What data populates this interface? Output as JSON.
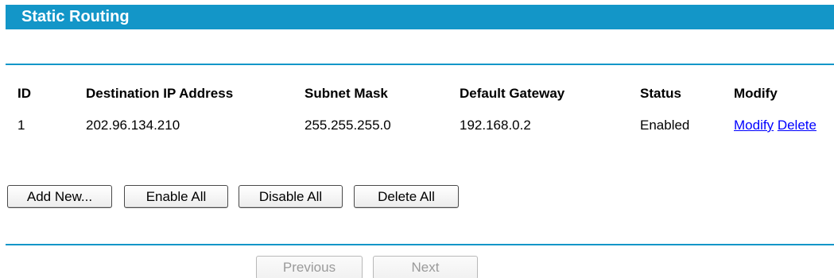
{
  "header": {
    "title": "Static Routing"
  },
  "table": {
    "columns": [
      "ID",
      "Destination IP Address",
      "Subnet Mask",
      "Default Gateway",
      "Status",
      "Modify"
    ],
    "rows": [
      {
        "id": "1",
        "destination": "202.96.134.210",
        "subnet_mask": "255.255.255.0",
        "gateway": "192.168.0.2",
        "status": "Enabled",
        "modify_label": "Modify",
        "delete_label": "Delete"
      }
    ]
  },
  "actions": {
    "add_new": "Add New...",
    "enable_all": "Enable All",
    "disable_all": "Disable All",
    "delete_all": "Delete All"
  },
  "pagination": {
    "previous": "Previous",
    "next": "Next"
  },
  "colors": {
    "accent": "#1396c8",
    "link": "#0000ff"
  }
}
